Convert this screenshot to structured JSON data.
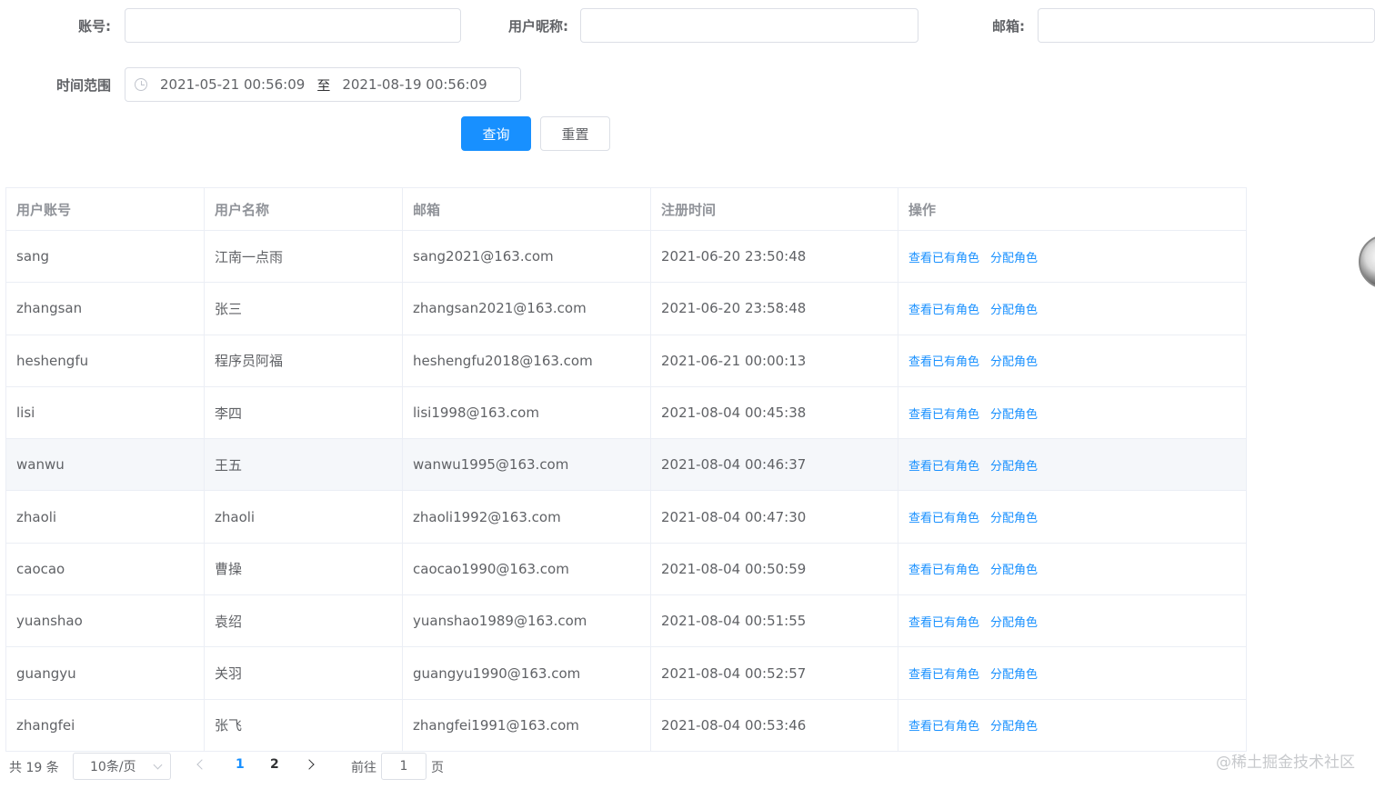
{
  "search": {
    "account_label": "账号:",
    "account_value": "",
    "nickname_label": "用户昵称:",
    "nickname_value": "",
    "email_label": "邮箱:",
    "email_value": "",
    "time_range_label": "时间范围",
    "start_time": "2021-05-21 00:56:09",
    "range_separator": "至",
    "end_time": "2021-08-19 00:56:09",
    "query_button": "查询",
    "reset_button": "重置"
  },
  "table": {
    "columns": [
      "用户账号",
      "用户名称",
      "邮箱",
      "注册时间",
      "操作"
    ],
    "actions": {
      "view_roles": "查看已有角色",
      "assign_role": "分配角色"
    },
    "rows": [
      {
        "account": "sang",
        "name": "江南一点雨",
        "email": "sang2021@163.com",
        "registered": "2021-06-20 23:50:48"
      },
      {
        "account": "zhangsan",
        "name": "张三",
        "email": "zhangsan2021@163.com",
        "registered": "2021-06-20 23:58:48"
      },
      {
        "account": "heshengfu",
        "name": "程序员阿福",
        "email": "heshengfu2018@163.com",
        "registered": "2021-06-21 00:00:13"
      },
      {
        "account": "lisi",
        "name": "李四",
        "email": "lisi1998@163.com",
        "registered": "2021-08-04 00:45:38"
      },
      {
        "account": "wanwu",
        "name": "王五",
        "email": "wanwu1995@163.com",
        "registered": "2021-08-04 00:46:37"
      },
      {
        "account": "zhaoli",
        "name": "zhaoli",
        "email": "zhaoli1992@163.com",
        "registered": "2021-08-04 00:47:30"
      },
      {
        "account": "caocao",
        "name": "曹操",
        "email": "caocao1990@163.com",
        "registered": "2021-08-04 00:50:59"
      },
      {
        "account": "yuanshao",
        "name": "袁绍",
        "email": "yuanshao1989@163.com",
        "registered": "2021-08-04 00:51:55"
      },
      {
        "account": "guangyu",
        "name": "关羽",
        "email": "guangyu1990@163.com",
        "registered": "2021-08-04 00:52:57"
      },
      {
        "account": "zhangfei",
        "name": "张飞",
        "email": "zhangfei1991@163.com",
        "registered": "2021-08-04 00:53:46"
      }
    ]
  },
  "pagination": {
    "total_text": "共 19 条",
    "page_size": "10条/页",
    "pages": [
      "1",
      "2"
    ],
    "current_page": "1",
    "goto_label": "前往",
    "goto_value": "1",
    "goto_unit": "页"
  },
  "watermark": "@稀土掘金技术社区",
  "colors": {
    "primary": "#1890ff",
    "row_hover": "#f5f7fa",
    "border": "#ebeef5"
  }
}
